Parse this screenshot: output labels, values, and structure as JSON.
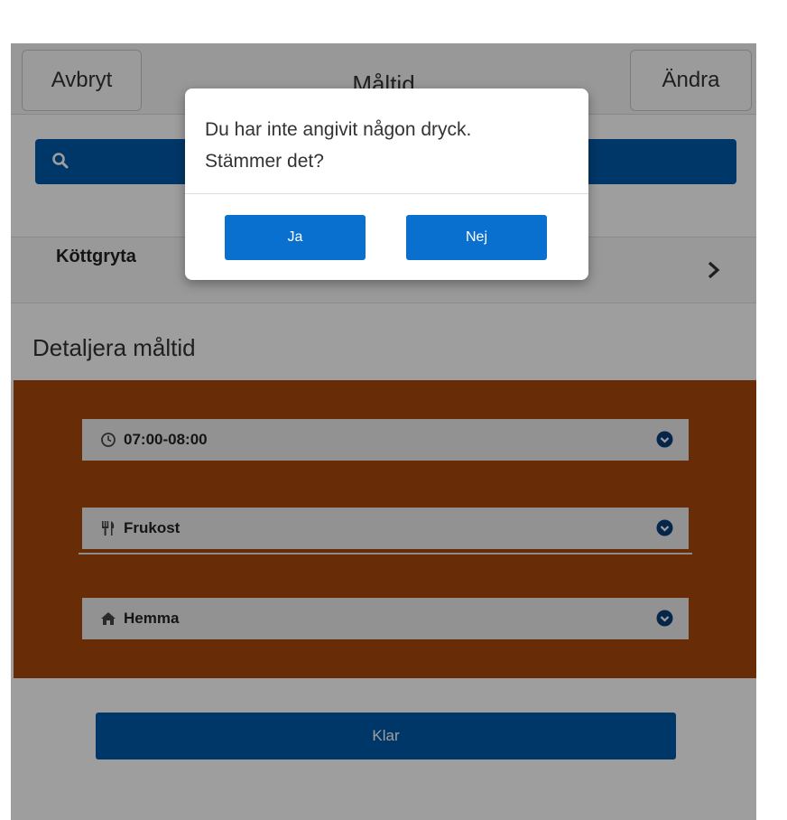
{
  "header": {
    "cancel_label": "Avbryt",
    "title": "Måltid",
    "edit_label": "Ändra"
  },
  "search": {
    "icon": "search-icon",
    "color": "#005aaa"
  },
  "food_list": [
    {
      "label": "Köttgryta"
    }
  ],
  "details": {
    "section_title": "Detaljera måltid",
    "panel_color": "#a84a0a",
    "time": {
      "icon": "clock-icon",
      "value": "07:00-08:00"
    },
    "meal_type": {
      "icon": "cutlery-icon",
      "value": "Frukost"
    },
    "location": {
      "icon": "home-icon",
      "value": "Hemma"
    }
  },
  "done_label": "Klar",
  "dialog": {
    "message_line1": "Du har inte angivit någon dryck.",
    "message_line2": "Stämmer det?",
    "yes_label": "Ja",
    "no_label": "Nej",
    "button_color": "#0a70d0"
  }
}
